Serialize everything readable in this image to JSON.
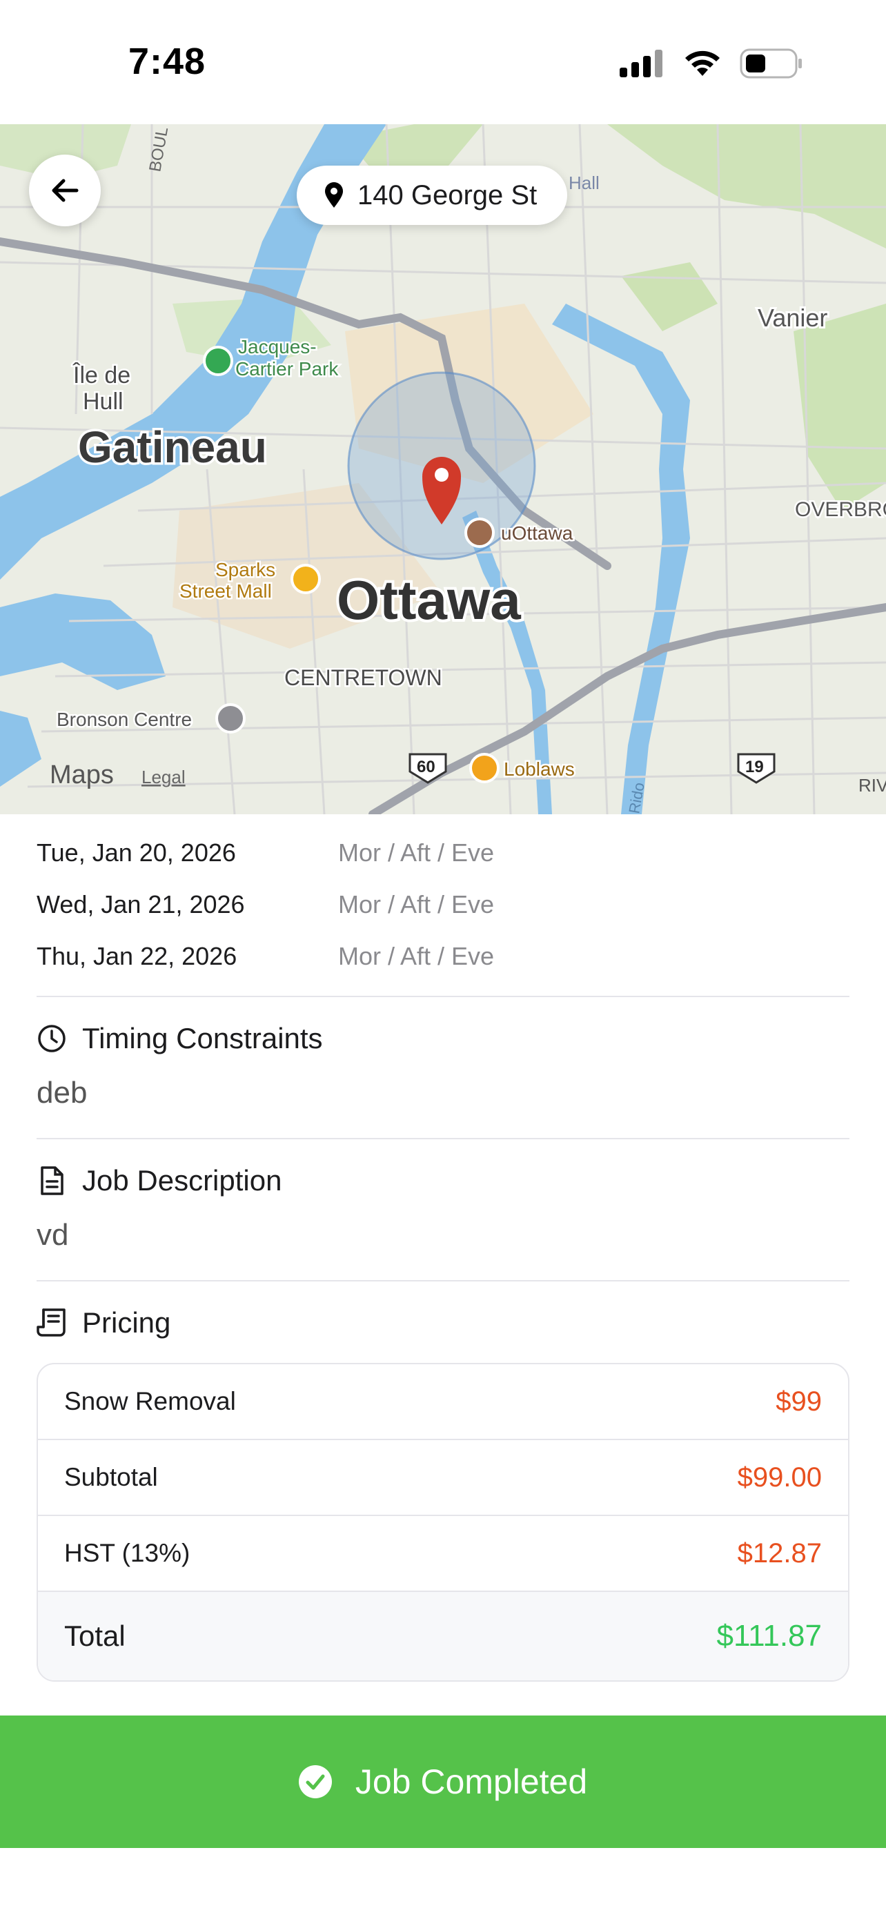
{
  "status_bar": {
    "time": "7:48"
  },
  "map": {
    "address": "140 George St",
    "labels": {
      "vanier": "Vanier",
      "jacques_cartier": "Jacques-\nCartier Park",
      "ile_de_hull_1": "Île de",
      "ile_de_hull_2": "Hull",
      "gatineau": "Gatineau",
      "overbrook": "OVERBRO",
      "uottawa": "uOttawa",
      "sparks_1": "Sparks",
      "sparks_2": "Street Mall",
      "ottawa": "Ottawa",
      "centretown": "CENTRETOWN",
      "bronson": "Bronson Centre",
      "loblaws": "Loblaws",
      "boul": "BOUL",
      "route60": "60",
      "route19": "19",
      "maps": "Maps",
      "legal": "Legal",
      "hall": "Hall",
      "riv": "RIV",
      "rido": "Rido"
    }
  },
  "availability": [
    {
      "date": "Tue, Jan 20, 2026",
      "slots": "Mor / Aft / Eve"
    },
    {
      "date": "Wed, Jan 21, 2026",
      "slots": "Mor / Aft / Eve"
    },
    {
      "date": "Thu, Jan 22, 2026",
      "slots": "Mor / Aft / Eve"
    }
  ],
  "timing": {
    "title": "Timing Constraints",
    "value": "deb"
  },
  "description": {
    "title": "Job Description",
    "value": "vd"
  },
  "pricing": {
    "title": "Pricing",
    "rows": [
      {
        "label": "Snow Removal",
        "amount": "$99"
      },
      {
        "label": "Subtotal",
        "amount": "$99.00"
      },
      {
        "label": "HST (13%)",
        "amount": "$12.87"
      }
    ],
    "total": {
      "label": "Total",
      "amount": "$111.87"
    }
  },
  "action": {
    "label": "Job Completed"
  },
  "colors": {
    "accent_green": "#55c24a",
    "price_orange": "#e8501f",
    "total_green": "#34c759"
  }
}
